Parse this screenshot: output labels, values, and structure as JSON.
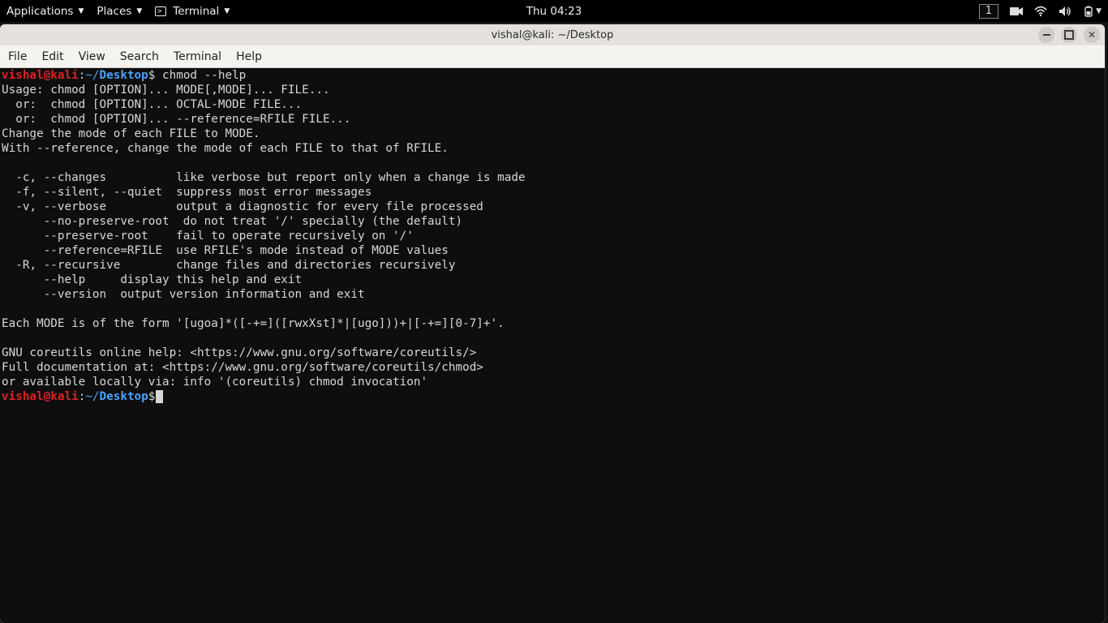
{
  "topbar": {
    "applications": "Applications",
    "places": "Places",
    "terminal": "Terminal",
    "clock": "Thu 04:23",
    "workspace": "1"
  },
  "window": {
    "title": "vishal@kali: ~/Desktop"
  },
  "menubar": {
    "file": "File",
    "edit": "Edit",
    "view": "View",
    "search": "Search",
    "terminal": "Terminal",
    "help": "Help"
  },
  "prompt": {
    "userhost": "vishal@kali",
    "sep": ":",
    "tilde": "~/",
    "path": "Desktop",
    "sigil": "$"
  },
  "command1": " chmod --help",
  "output": "Usage: chmod [OPTION]... MODE[,MODE]... FILE...\n  or:  chmod [OPTION]... OCTAL-MODE FILE...\n  or:  chmod [OPTION]... --reference=RFILE FILE...\nChange the mode of each FILE to MODE.\nWith --reference, change the mode of each FILE to that of RFILE.\n\n  -c, --changes          like verbose but report only when a change is made\n  -f, --silent, --quiet  suppress most error messages\n  -v, --verbose          output a diagnostic for every file processed\n      --no-preserve-root  do not treat '/' specially (the default)\n      --preserve-root    fail to operate recursively on '/'\n      --reference=RFILE  use RFILE's mode instead of MODE values\n  -R, --recursive        change files and directories recursively\n      --help     display this help and exit\n      --version  output version information and exit\n\nEach MODE is of the form '[ugoa]*([-+=]([rwxXst]*|[ugo]))+|[-+=][0-7]+'.\n\nGNU coreutils online help: <https://www.gnu.org/software/coreutils/>\nFull documentation at: <https://www.gnu.org/software/coreutils/chmod>\nor available locally via: info '(coreutils) chmod invocation'"
}
